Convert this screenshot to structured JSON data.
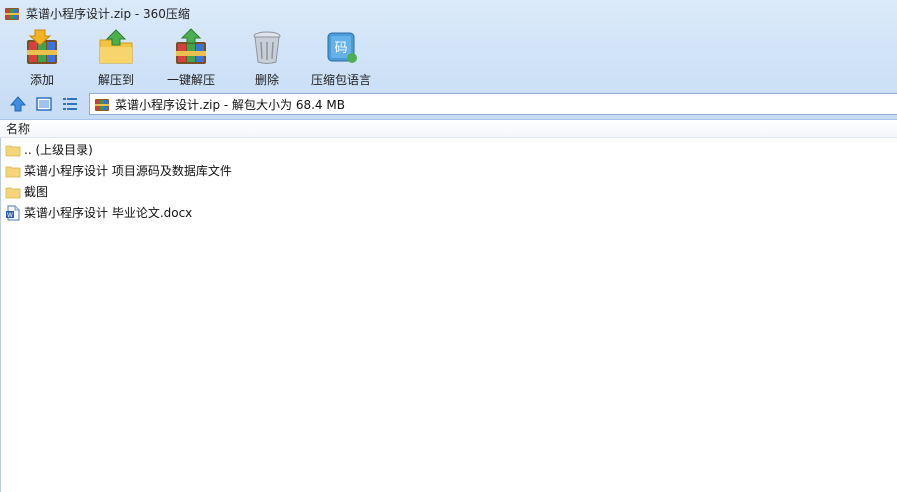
{
  "window": {
    "title": "菜谱小程序设计.zip - 360压缩",
    "title_icon": "archive-books-icon"
  },
  "toolbar": {
    "buttons": [
      {
        "id": "add",
        "label": "添加",
        "icon": "add-archive-icon"
      },
      {
        "id": "extract_to",
        "label": "解压到",
        "icon": "extract-to-folder-icon"
      },
      {
        "id": "one_click_extract",
        "label": "一键解压",
        "icon": "one-click-extract-icon"
      },
      {
        "id": "delete",
        "label": "删除",
        "icon": "trash-can-icon"
      },
      {
        "id": "encoding",
        "label": "压缩包语言",
        "icon": "encoding-language-icon"
      }
    ]
  },
  "navigation": {
    "up_icon": "up-arrow-icon",
    "view_icon": "view-mode-icon",
    "list_icon": "list-view-icon",
    "address_text": "菜谱小程序设计.zip - 解包大小为 68.4 MB"
  },
  "columns": {
    "name_header": "名称"
  },
  "files": [
    {
      "name": ".. (上级目录)",
      "icon": "folder-icon"
    },
    {
      "name": "菜谱小程序设计 项目源码及数据库文件",
      "icon": "folder-icon"
    },
    {
      "name": "截图",
      "icon": "folder-icon"
    },
    {
      "name": "菜谱小程序设计 毕业论文.docx",
      "icon": "word-document-icon"
    }
  ],
  "colors": {
    "chrome_bg": "#cfe2f7",
    "folder": "#f7d774",
    "accent_blue": "#3b82d6"
  }
}
